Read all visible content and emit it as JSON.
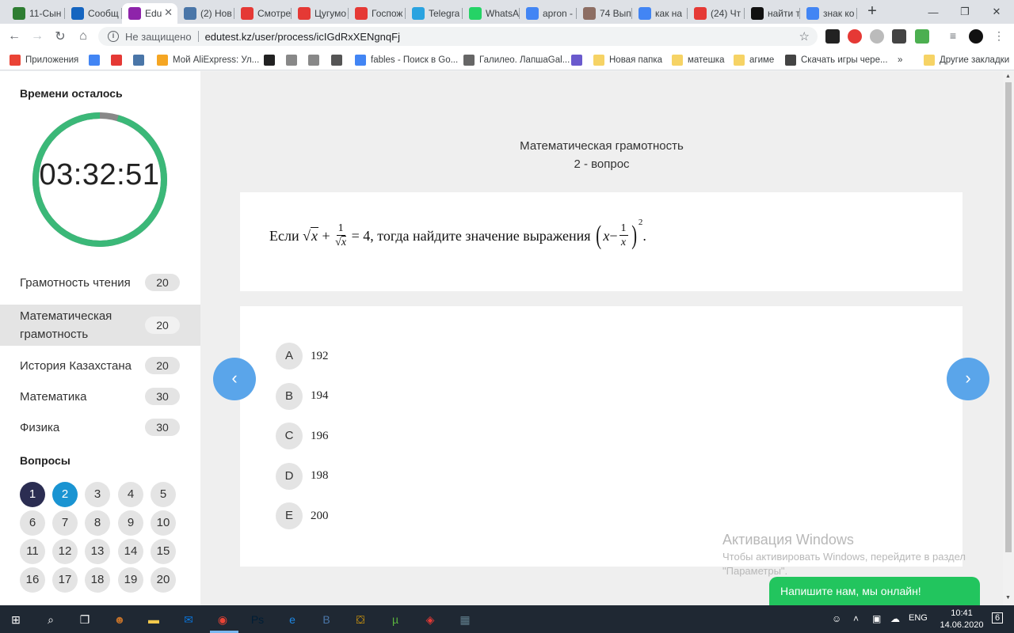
{
  "browser": {
    "tabs": [
      {
        "label": "11-Сын",
        "icon_color": "#2e7d32",
        "icon": "drive-icon"
      },
      {
        "label": "Сообщ",
        "icon_color": "#1565c0",
        "icon": "chat-icon"
      },
      {
        "label": "Edu",
        "icon_color": "#8e24aa",
        "icon": "edu-icon",
        "active": true
      },
      {
        "label": "(2) Нов",
        "icon_color": "#4a76a8",
        "icon": "vk-icon"
      },
      {
        "label": "Смотре",
        "icon_color": "#e53935",
        "icon": "a-icon"
      },
      {
        "label": "Цугумо",
        "icon_color": "#e53935",
        "icon": "a-icon"
      },
      {
        "label": "Госпож",
        "icon_color": "#e53935",
        "icon": "a-icon"
      },
      {
        "label": "Telegra",
        "icon_color": "#2aa3e0",
        "icon": "telegram-icon"
      },
      {
        "label": "WhatsA",
        "icon_color": "#25d366",
        "icon": "whatsapp-icon"
      },
      {
        "label": "apron -",
        "icon_color": "#4285f4",
        "icon": "google-icon"
      },
      {
        "label": "74 Вып",
        "icon_color": "#8d6e63",
        "icon": "best-icon"
      },
      {
        "label": "как на",
        "icon_color": "#4285f4",
        "icon": "google-icon"
      },
      {
        "label": "(24) Чт",
        "icon_color": "#e53935",
        "icon": "youtube-icon"
      },
      {
        "label": "найти т",
        "icon_color": "#111111",
        "icon": "z-icon"
      },
      {
        "label": "знак ко",
        "icon_color": "#4285f4",
        "icon": "google-icon"
      }
    ],
    "not_secure": "Не защищено",
    "url": "edutest.kz/user/process/icIGdRxXENgnqFj",
    "bookmarks": [
      {
        "label": "Приложения",
        "icon_color": "#ea4335"
      },
      {
        "label": "",
        "icon_color": "#4285f4"
      },
      {
        "label": "",
        "icon_color": "#e53935"
      },
      {
        "label": "",
        "icon_color": "#4a76a8"
      },
      {
        "label": "Мой AliExpress: Ул...",
        "icon_color": "#f5a623"
      },
      {
        "label": "",
        "icon_color": "#222222"
      },
      {
        "label": "",
        "icon_color": "#888888"
      },
      {
        "label": "",
        "icon_color": "#888888"
      },
      {
        "label": "",
        "icon_color": "#555555"
      },
      {
        "label": "fables - Поиск в Go...",
        "icon_color": "#4285f4"
      },
      {
        "label": "Галилео. ЛапшаGal...",
        "icon_color": "#666666"
      },
      {
        "label": "",
        "icon_color": "#6a5acd"
      },
      {
        "label": "Новая папка",
        "icon_color": "#f6d365"
      },
      {
        "label": "матешка",
        "icon_color": "#f6d365"
      },
      {
        "label": "агиме",
        "icon_color": "#f6d365"
      },
      {
        "label": "Скачать игры чере...",
        "icon_color": "#444444"
      }
    ],
    "more_bookmarks": "»",
    "other_bookmarks": "Другие закладки"
  },
  "sidebar": {
    "timer_title": "Времени осталось",
    "timer_value": "03:32:51",
    "timer_remaining_fraction": 0.955,
    "timer_color": "#3bb878",
    "subjects": [
      {
        "name": "Грамотность чтения",
        "count": "20"
      },
      {
        "name": "Математическая грамотность",
        "count": "20",
        "active": true
      },
      {
        "name": "История Казахстана",
        "count": "20"
      },
      {
        "name": "Математика",
        "count": "30"
      },
      {
        "name": "Физика",
        "count": "30"
      }
    ],
    "questions_title": "Вопросы",
    "questions": [
      "1",
      "2",
      "3",
      "4",
      "5",
      "6",
      "7",
      "8",
      "9",
      "10",
      "11",
      "12",
      "13",
      "14",
      "15",
      "16",
      "17",
      "18",
      "19",
      "20"
    ],
    "answered_question": "1",
    "current_question": "2"
  },
  "main": {
    "subject_title": "Математическая грамотность",
    "question_label": "2 - вопрос",
    "question": {
      "prefix": "Если",
      "sqrt_var": "x",
      "plus": "+",
      "frac_num": "1",
      "frac_den_var": "x",
      "equals": "= 4",
      "middle": ", тогда найдите значение выражения",
      "expr_var": "x",
      "expr_minus": "−",
      "expr_frac_num": "1",
      "expr_frac_den": "x",
      "exponent": "2",
      "end": "."
    },
    "options": [
      {
        "letter": "A",
        "value": "192"
      },
      {
        "letter": "B",
        "value": "194"
      },
      {
        "letter": "C",
        "value": "196"
      },
      {
        "letter": "D",
        "value": "198"
      },
      {
        "letter": "E",
        "value": "200"
      }
    ],
    "prev_icon": "‹",
    "next_icon": "›"
  },
  "overlay": {
    "activation_title": "Активация Windows",
    "activation_text": "Чтобы активировать Windows, перейдите в раздел \"Параметры\".",
    "chat_label": "Напишите нам, мы онлайн!"
  },
  "taskbar": {
    "language": "ENG",
    "time": "10:41",
    "date": "14.06.2020",
    "notifications": "6",
    "apps": [
      "windows-start-icon",
      "search-icon",
      "task-view-icon",
      "avatar-app-icon",
      "file-explorer-icon",
      "mail-icon",
      "chrome-icon",
      "photoshop-icon",
      "edge-icon",
      "vk-icon",
      "store-icon",
      "utorrent-icon",
      "games-icon",
      "calculator-icon"
    ],
    "app_colors": [
      "#ffffff",
      "#ffffff",
      "#ffffff",
      "#c0702a",
      "#f2c94c",
      "#0a74d9",
      "#ea4335",
      "#001e36",
      "#1e88e5",
      "#4a76a8",
      "#ffb300",
      "#5ab33e",
      "#e53935",
      "#607d8b"
    ]
  }
}
